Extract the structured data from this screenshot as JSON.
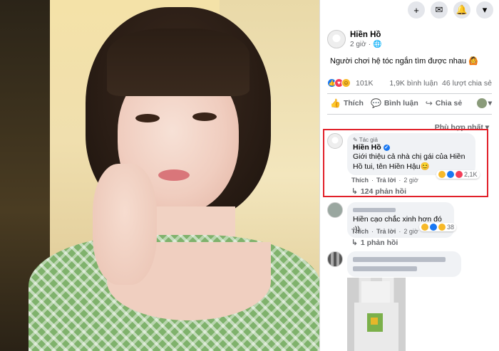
{
  "top_bar": {
    "icons": [
      "plus-icon",
      "messenger-icon",
      "notification-icon",
      "account-caret-icon"
    ],
    "glyphs": [
      "+",
      "✉",
      "🔔",
      "▾"
    ]
  },
  "post": {
    "author": "Hiền Hồ",
    "time": "2 giờ",
    "caption": "Người chơi hệ tóc ngắn tìm được nhau 🙆",
    "reactions_count": "101K",
    "comments_count": "1,9K bình luận",
    "shares_count": "46 lượt chia sẻ",
    "actions": {
      "like": "Thích",
      "comment": "Bình luận",
      "share": "Chia sẻ"
    },
    "sort_label": "Phù hợp nhất ▾"
  },
  "comments": [
    {
      "badge": "Tác giả",
      "name": "Hiền Hồ",
      "text_line1": "Giới thiệu cả nhà chị gái của Hiền",
      "text_line2": "Hồ tui, tên Hiền Hậu😊",
      "like": "Thích",
      "reply": "Trả lời",
      "time": "2 giờ",
      "react_count": "2,1K",
      "replies": "124 phản hồi"
    },
    {
      "text": "Hiền cạo chắc xinh hơn đó :))",
      "like": "Thích",
      "reply": "Trả lời",
      "time": "2 giờ",
      "react_count": "38",
      "replies": "1 phản hồi"
    }
  ],
  "colors": {
    "accent": "#1877f2",
    "highlight": "#e12029",
    "muted": "#65676b",
    "bubble": "#f0f2f5"
  }
}
